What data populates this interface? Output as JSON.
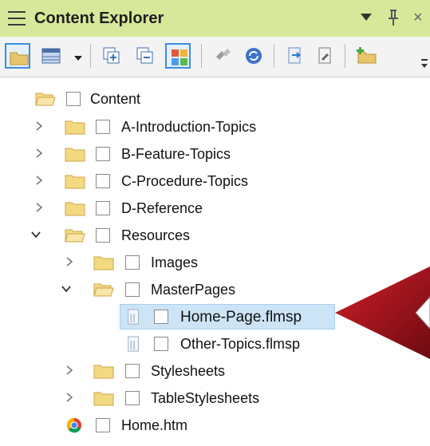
{
  "panel": {
    "title": "Content Explorer"
  },
  "tree": [
    {
      "label": "Content"
    },
    {
      "label": "A-Introduction-Topics"
    },
    {
      "label": "B-Feature-Topics"
    },
    {
      "label": "C-Procedure-Topics"
    },
    {
      "label": "D-Reference"
    },
    {
      "label": "Resources"
    },
    {
      "label": "Images"
    },
    {
      "label": "MasterPages"
    },
    {
      "label": "Home-Page.flmsp"
    },
    {
      "label": "Other-Topics.flmsp"
    },
    {
      "label": "Stylesheets"
    },
    {
      "label": "TableStylesheets"
    },
    {
      "label": "Home.htm"
    }
  ],
  "colors": {
    "accent": "#3c8de0",
    "title_bg": "#d8e89a",
    "selection": "#cde4f6",
    "arrow": "#b0121b"
  }
}
